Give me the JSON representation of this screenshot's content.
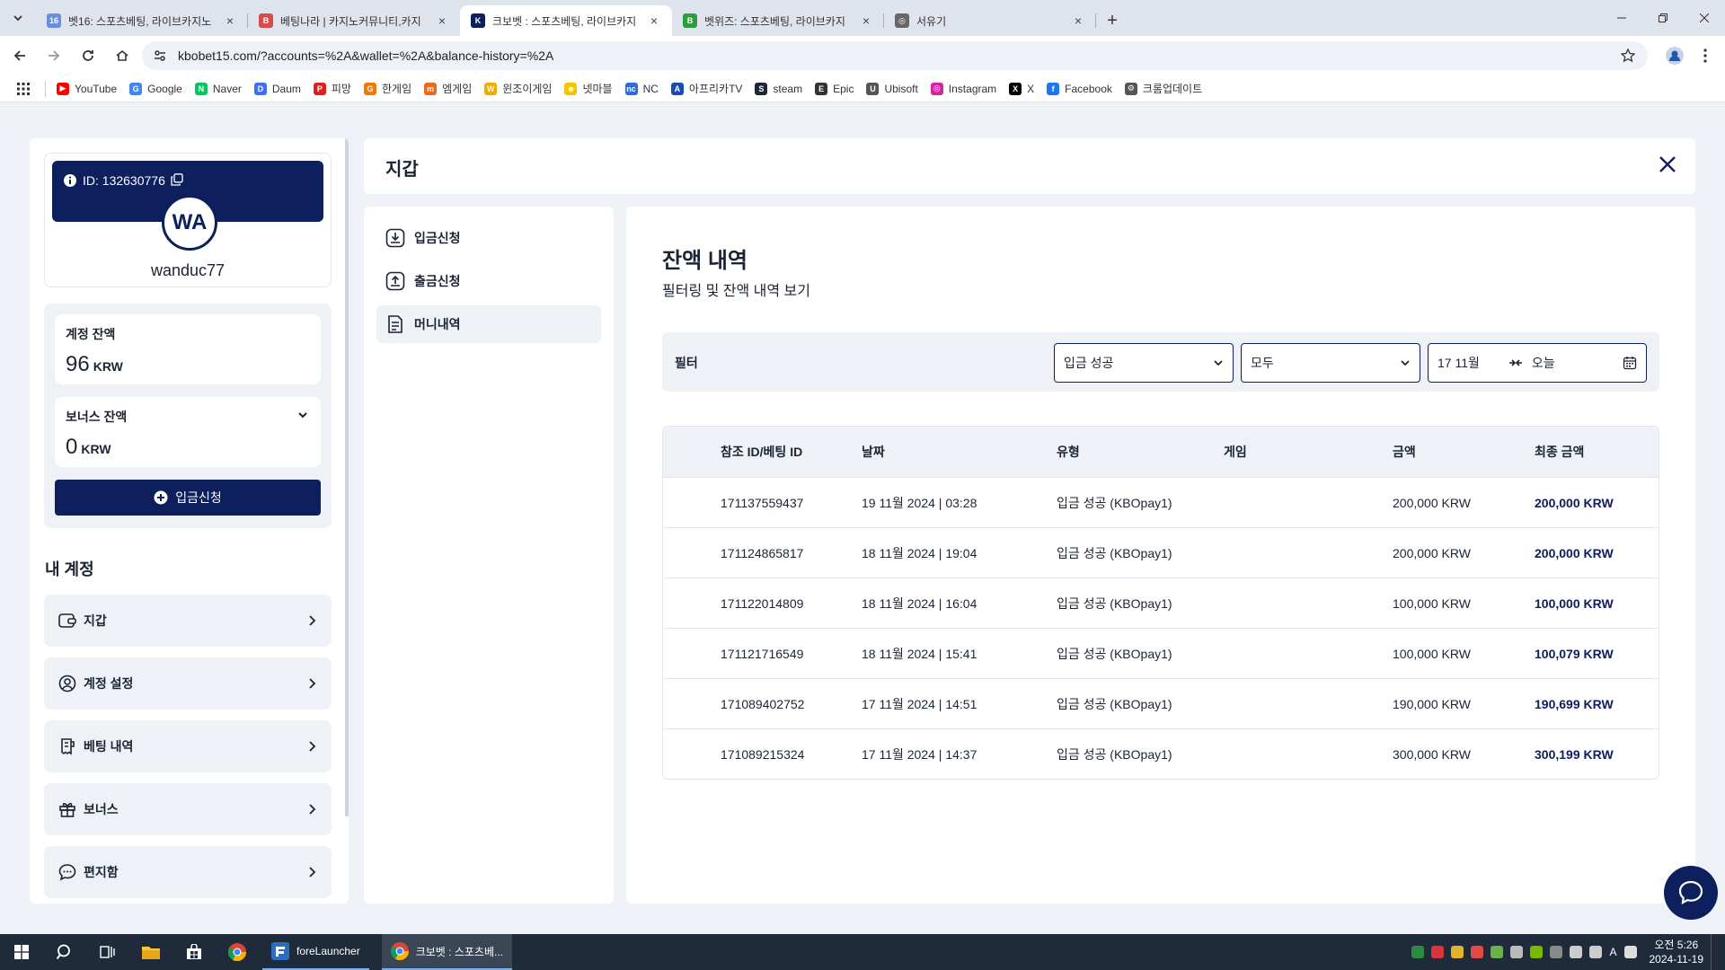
{
  "browser": {
    "tabs": [
      {
        "title": "벳16: 스포츠베팅, 라이브카지노",
        "fav": "16",
        "color": "#6b8fd8"
      },
      {
        "title": "베팅나라 | 카지노커뮤니티,카지",
        "fav": "B",
        "color": "#d94b4b"
      },
      {
        "title": "크보벳 : 스포츠베팅, 라이브카지",
        "fav": "K",
        "color": "#0d1f5c"
      },
      {
        "title": "벳위즈: 스포츠베팅, 라이브카지",
        "fav": "B",
        "color": "#2e9b3e"
      },
      {
        "title": "서유기",
        "fav": "◎",
        "color": "#666666"
      }
    ],
    "active_tab": 2,
    "url": "kbobet15.com/?accounts=%2A&wallet=%2A&balance-history=%2A",
    "bookmarks": [
      {
        "label": "YouTube",
        "icon": "youtube-icon",
        "color": "#ff0000",
        "glyph": "▶"
      },
      {
        "label": "Google",
        "icon": "google-icon",
        "color": "#4285f4",
        "glyph": "G"
      },
      {
        "label": "Naver",
        "icon": "naver-icon",
        "color": "#03c75a",
        "glyph": "N"
      },
      {
        "label": "Daum",
        "icon": "daum-icon",
        "color": "#3d6ef5",
        "glyph": "D"
      },
      {
        "label": "피망",
        "icon": "pmang-icon",
        "color": "#e02020",
        "glyph": "P"
      },
      {
        "label": "한게임",
        "icon": "hangame-icon",
        "color": "#f07800",
        "glyph": "G"
      },
      {
        "label": "엠게임",
        "icon": "mgame-icon",
        "color": "#e86a1a",
        "glyph": "m"
      },
      {
        "label": "윈조이게임",
        "icon": "winjoy-icon",
        "color": "#f2a900",
        "glyph": "W"
      },
      {
        "label": "넷마블",
        "icon": "netmarble-icon",
        "color": "#f7c500",
        "glyph": "☻"
      },
      {
        "label": "NC",
        "icon": "nc-icon",
        "color": "#2b6cd9",
        "glyph": "nc"
      },
      {
        "label": "아프리카TV",
        "icon": "afreecatv-icon",
        "color": "#1a4bb3",
        "glyph": "A"
      },
      {
        "label": "steam",
        "icon": "steam-icon",
        "color": "#1b2838",
        "glyph": "S"
      },
      {
        "label": "Epic",
        "icon": "epic-icon",
        "color": "#333333",
        "glyph": "E"
      },
      {
        "label": "Ubisoft",
        "icon": "ubisoft-icon",
        "color": "#555555",
        "glyph": "U"
      },
      {
        "label": "Instagram",
        "icon": "instagram-icon",
        "color": "#d6249f",
        "glyph": "◎"
      },
      {
        "label": "X",
        "icon": "x-icon",
        "color": "#000000",
        "glyph": "X"
      },
      {
        "label": "Facebook",
        "icon": "facebook-icon",
        "color": "#1877f2",
        "glyph": "f"
      },
      {
        "label": "크롬업데이트",
        "icon": "gear-icon",
        "color": "#555555",
        "glyph": "⚙"
      }
    ]
  },
  "user": {
    "id_label": "ID: 132630776",
    "initials": "WA",
    "username": "wanduc77"
  },
  "balances": {
    "account_label": "계정 잔액",
    "account_value": "96",
    "account_currency": "KRW",
    "bonus_label": "보너스 잔액",
    "bonus_value": "0",
    "bonus_currency": "KRW",
    "deposit_button": "입금신청"
  },
  "my_account": {
    "title": "내 계정",
    "items": [
      {
        "label": "지갑",
        "icon": "wallet-icon"
      },
      {
        "label": "계정 설정",
        "icon": "user-settings-icon"
      },
      {
        "label": "베팅 내역",
        "icon": "receipt-icon"
      },
      {
        "label": "보너스",
        "icon": "gift-icon"
      },
      {
        "label": "편지함",
        "icon": "messages-icon"
      }
    ]
  },
  "wallet": {
    "title": "지갑",
    "submenu": [
      {
        "label": "입금신청",
        "icon": "deposit-icon"
      },
      {
        "label": "출금신청",
        "icon": "withdraw-icon"
      },
      {
        "label": "머니내역",
        "icon": "money-history-icon"
      }
    ],
    "active_submenu": 2
  },
  "history": {
    "title": "잔액 내역",
    "subtitle": "필터링 및 잔액 내역 보기",
    "filter_label": "필터",
    "filter_type": "입금 성공",
    "filter_scope": "모두",
    "date_from": "17 11월",
    "date_to": "오늘",
    "columns": [
      "참조 ID/베팅 ID",
      "날짜",
      "유형",
      "게임",
      "금액",
      "최종 금액"
    ],
    "rows": [
      {
        "ref": "171137559437",
        "date": "19 11월 2024 | 03:28",
        "type": "입금 성공 (KBOpay1)",
        "game": "",
        "amount": "200,000 KRW",
        "final": "200,000 KRW"
      },
      {
        "ref": "171124865817",
        "date": "18 11월 2024 | 19:04",
        "type": "입금 성공 (KBOpay1)",
        "game": "",
        "amount": "200,000 KRW",
        "final": "200,000 KRW"
      },
      {
        "ref": "171122014809",
        "date": "18 11월 2024 | 16:04",
        "type": "입금 성공 (KBOpay1)",
        "game": "",
        "amount": "100,000 KRW",
        "final": "100,000 KRW"
      },
      {
        "ref": "171121716549",
        "date": "18 11월 2024 | 15:41",
        "type": "입금 성공 (KBOpay1)",
        "game": "",
        "amount": "100,000 KRW",
        "final": "100,079 KRW"
      },
      {
        "ref": "171089402752",
        "date": "17 11월 2024 | 14:51",
        "type": "입금 성공 (KBOpay1)",
        "game": "",
        "amount": "190,000 KRW",
        "final": "190,699 KRW"
      },
      {
        "ref": "171089215324",
        "date": "17 11월 2024 | 14:37",
        "type": "입금 성공 (KBOpay1)",
        "game": "",
        "amount": "300,000 KRW",
        "final": "300,199 KRW"
      }
    ]
  },
  "taskbar": {
    "apps": [
      {
        "label": "foreLauncher",
        "icon": "forelauncher-icon"
      },
      {
        "label": "크보벳 : 스포츠베...",
        "icon": "chrome-icon"
      }
    ],
    "time": "오전 5:26",
    "date": "2024-11-19",
    "ime": "A"
  }
}
